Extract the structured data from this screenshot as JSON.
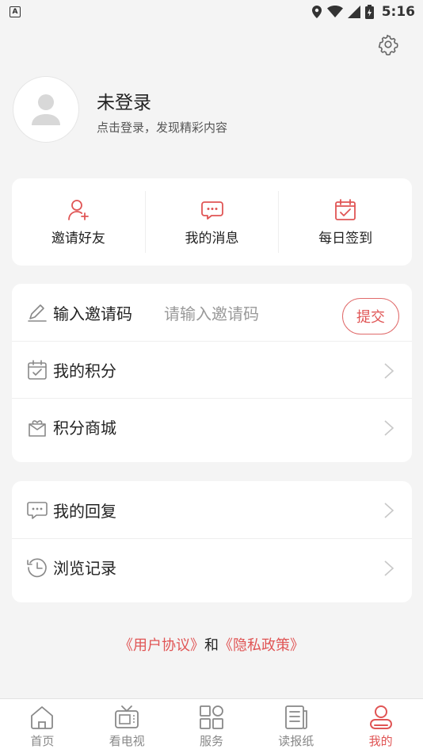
{
  "status_bar": {
    "left_badge": "A",
    "time": "5:16"
  },
  "profile": {
    "name": "未登录",
    "subtitle": "点击登录，发现精彩内容"
  },
  "quick_actions": [
    {
      "label": "邀请好友",
      "icon": "add-user-icon"
    },
    {
      "label": "我的消息",
      "icon": "message-icon"
    },
    {
      "label": "每日签到",
      "icon": "calendar-check-icon"
    }
  ],
  "invite": {
    "label": "输入邀请码",
    "placeholder": "请输入邀请码",
    "submit_label": "提交"
  },
  "menu_group1": [
    {
      "label": "我的积分",
      "icon": "points-calendar-icon"
    },
    {
      "label": "积分商城",
      "icon": "gift-box-icon"
    }
  ],
  "menu_group2": [
    {
      "label": "我的回复",
      "icon": "reply-chat-icon"
    },
    {
      "label": "浏览记录",
      "icon": "history-icon"
    }
  ],
  "agreement": {
    "user_agreement": "《用户协议》",
    "and": "和",
    "privacy_policy": "《隐私政策》"
  },
  "tabs": [
    {
      "label": "首页",
      "icon": "home-icon"
    },
    {
      "label": "看电视",
      "icon": "tv-icon"
    },
    {
      "label": "服务",
      "icon": "services-grid-icon"
    },
    {
      "label": "读报纸",
      "icon": "newspaper-icon"
    },
    {
      "label": "我的",
      "icon": "user-icon",
      "active": true
    }
  ],
  "colors": {
    "accent": "#e05555",
    "background": "#f4f4f4",
    "card": "#ffffff"
  }
}
